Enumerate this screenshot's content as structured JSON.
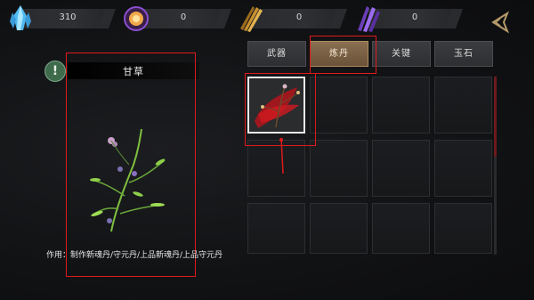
{
  "resources": [
    {
      "name": "blue-crystal-icon",
      "value": "310",
      "color": "#7fd3ff"
    },
    {
      "name": "orb-icon",
      "value": "0",
      "color": "#f0a94a"
    },
    {
      "name": "gold-feathers-icon",
      "value": "0",
      "color": "#d7a74a"
    },
    {
      "name": "purple-crystal-icon",
      "value": "0",
      "color": "#8a5cd6"
    }
  ],
  "detail": {
    "title": "甘草",
    "description": "作用：制作新魂丹/守元丹/上品新魂丹/上品守元丹"
  },
  "tabs": [
    {
      "label": "武器",
      "active": false
    },
    {
      "label": "炼丹",
      "active": true
    },
    {
      "label": "关键",
      "active": false
    },
    {
      "label": "玉石",
      "active": false
    }
  ],
  "grid": {
    "rows": 3,
    "cols": 4,
    "items": [
      {
        "name": "licorice-herb-item",
        "selected": true
      }
    ]
  },
  "colors": {
    "highlight": "#e0191c",
    "active_tab": "#7a6044",
    "info_badge": "#3e6b4c"
  }
}
